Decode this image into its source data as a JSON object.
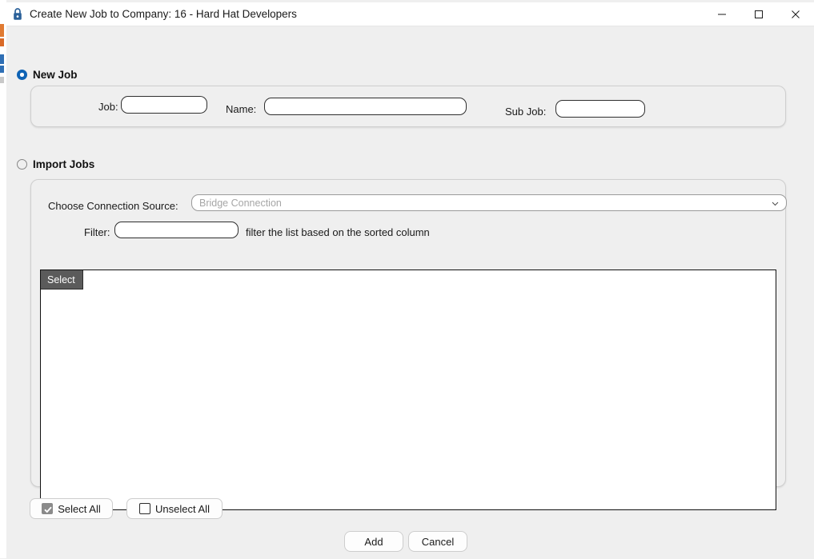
{
  "window": {
    "title": "Create New Job to Company: 16 - Hard Hat Developers",
    "lock_icon": "lock-icon",
    "minimize_label": "—",
    "maximize_label": "□",
    "close_label": "✕"
  },
  "background": {
    "bottom_text": "— —— ——— —— ——— ——",
    "top_text": "—————"
  },
  "new_job": {
    "radio_label": "New Job",
    "radio_selected": true,
    "job": {
      "label": "Job:",
      "value": "",
      "placeholder": ""
    },
    "name": {
      "label": "Name:",
      "value": "",
      "placeholder": ""
    },
    "sub_job": {
      "label": "Sub Job:",
      "value": "",
      "placeholder": ""
    }
  },
  "import_jobs": {
    "radio_label": "Import Jobs",
    "radio_selected": false,
    "connection": {
      "label": "Choose Connection Source:",
      "value": "Bridge Connection",
      "arrow_icon": "chevron-down-icon"
    },
    "filter": {
      "label": "Filter:",
      "value": "",
      "placeholder": "",
      "hint": "filter the list based on the sorted column"
    },
    "list": {
      "columns": [
        "Select"
      ],
      "rows": []
    },
    "select_all_label": "Select All",
    "unselect_all_label": "Unselect All",
    "select_all_checked": true,
    "unselect_all_checked": false
  },
  "footer": {
    "add_label": "Add",
    "cancel_label": "Cancel"
  },
  "colors": {
    "accent": "#0f63b5",
    "header_bg": "#5b5b5b",
    "window_bg": "#efefef",
    "lock": "#2a6099"
  }
}
